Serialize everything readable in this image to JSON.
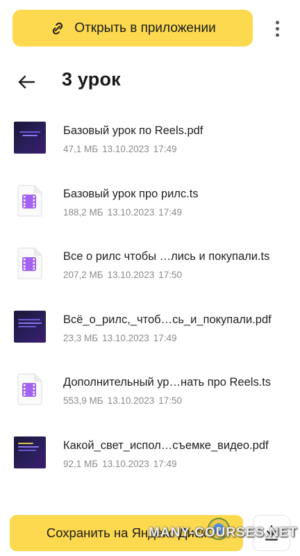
{
  "colors": {
    "accent": "#fcd94f",
    "file_icon_purple": "#a264f0",
    "meta_gray": "#8a8a8a"
  },
  "top_bar": {
    "open_app_label": "Открыть в приложении",
    "open_app_icon": "link-icon",
    "more_icon": "more-vertical-icon"
  },
  "header": {
    "back_icon": "arrow-left-icon",
    "title": "3 урок"
  },
  "files": [
    {
      "type": "pdf",
      "name": "Базовый урок по Reels.pdf",
      "size": "47,1 МБ",
      "date": "13.10.2023",
      "time": "17:49"
    },
    {
      "type": "video",
      "name": "Базовый урок про рилс.ts",
      "size": "188,2 МБ",
      "date": "13.10.2023",
      "time": "17:49"
    },
    {
      "type": "video",
      "name": "Все о рилс чтобы …лись и покупали.ts",
      "size": "207,2 МБ",
      "date": "13.10.2023",
      "time": "17:50"
    },
    {
      "type": "pdf",
      "name": "Всё_о_рилс,_чтоб…сь_и_покупали.pdf",
      "size": "23,3 МБ",
      "date": "13.10.2023",
      "time": "17:49"
    },
    {
      "type": "video",
      "name": "Дополнительный ур…нать про Reels.ts",
      "size": "553,9 МБ",
      "date": "13.10.2023",
      "time": "17:50"
    },
    {
      "type": "pdf",
      "name": "Какой_свет_испол…съемке_видео.pdf",
      "size": "92,1 МБ",
      "date": "13.10.2023",
      "time": "17:49"
    }
  ],
  "bottom_bar": {
    "save_label": "Сохранить на Яндекс Диск",
    "download_icon": "download-icon"
  },
  "watermark": {
    "text": "MANY-COURSES.NET"
  }
}
